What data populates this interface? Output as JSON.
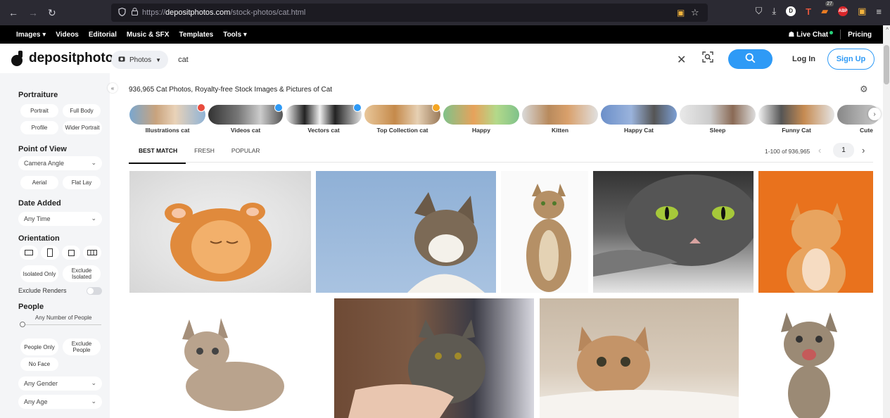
{
  "browser": {
    "url_prefix": "https://",
    "url_host": "depositphotos.com",
    "url_path": "/stock-photos/cat.html",
    "ext_badge_count": "27",
    "ext_abp": "ABP",
    "ext_d": "D"
  },
  "site_nav": {
    "items": [
      "Images ▾",
      "Videos",
      "Editorial",
      "Music & SFX",
      "Templates",
      "Tools ▾"
    ],
    "live_chat": "Live Chat",
    "pricing": "Pricing"
  },
  "header": {
    "logo": "depositphotos",
    "type_select": "Photos",
    "search_value": "cat",
    "login": "Log In",
    "signup": "Sign Up"
  },
  "sidebar": {
    "portraiture": {
      "heading": "Portraiture",
      "options": [
        "Portrait",
        "Full Body",
        "Profile",
        "Wider Portrait"
      ]
    },
    "point_of_view": {
      "heading": "Point of View",
      "select": "Camera Angle",
      "options": [
        "Aerial",
        "Flat Lay"
      ]
    },
    "date_added": {
      "heading": "Date Added",
      "select": "Any Time"
    },
    "orientation": {
      "heading": "Orientation",
      "isolated_only": "Isolated Only",
      "exclude_isolated": "Exclude Isolated",
      "exclude_renders": "Exclude Renders"
    },
    "people": {
      "heading": "People",
      "slider_label": "Any Number of People",
      "people_only": "People Only",
      "exclude_people": "Exclude People",
      "no_face": "No Face",
      "gender": "Any Gender",
      "age": "Any Age"
    }
  },
  "main": {
    "title": "936,965 Cat Photos, Royalty-free Stock Images & Pictures of Cat",
    "chips": [
      "Illustrations cat",
      "Videos cat",
      "Vectors cat",
      "Top Collection cat",
      "Happy",
      "Kitten",
      "Happy Cat",
      "Sleep",
      "Funny Cat",
      "Cute"
    ],
    "tabs": [
      "BEST MATCH",
      "FRESH",
      "POPULAR"
    ],
    "pager": {
      "range": "1-100 of 936,965",
      "page": "1"
    }
  },
  "colors": {
    "accent": "#2e9af6",
    "nav_bg": "#000000",
    "browser_bg": "#2b2a33",
    "sidebar_bg": "#f4f5f7"
  }
}
